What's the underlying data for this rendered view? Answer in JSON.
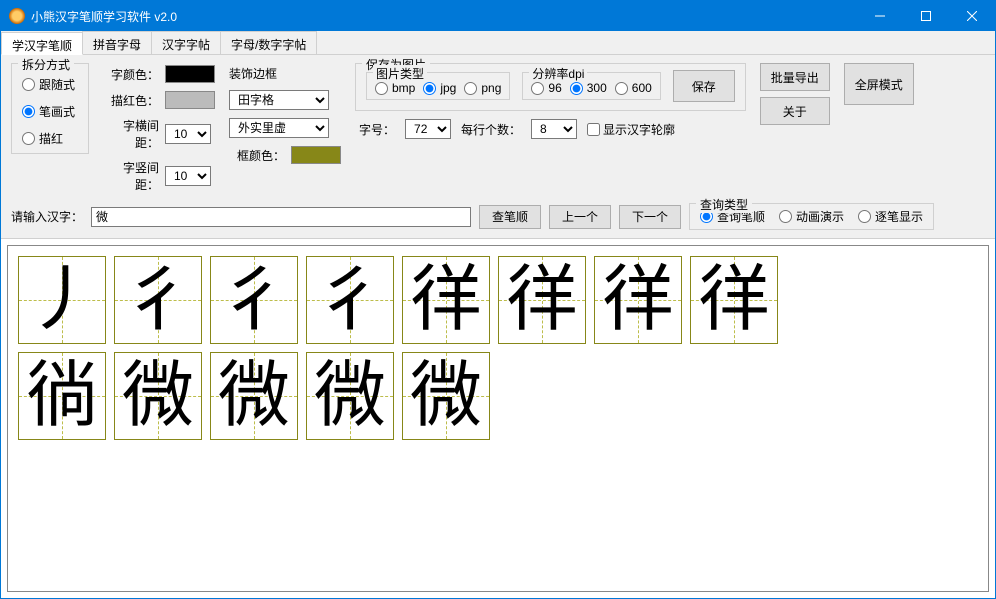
{
  "window": {
    "title": "小熊汉字笔顺学习软件 v2.0"
  },
  "tabs": [
    {
      "label": "学汉字笔顺",
      "active": true
    },
    {
      "label": "拼音字母",
      "active": false
    },
    {
      "label": "汉字字帖",
      "active": false
    },
    {
      "label": "字母/数字字帖",
      "active": false
    }
  ],
  "split": {
    "title": "拆分方式",
    "options": [
      "跟随式",
      "笔画式",
      "描红"
    ],
    "selected": "笔画式"
  },
  "font": {
    "color_label": "字颜色：",
    "trace_label": "描红色：",
    "hspace_label": "字横间距：",
    "vspace_label": "字竖间距：",
    "hspace_value": "10",
    "vspace_value": "10"
  },
  "decor": {
    "title": "装饰边框",
    "grid_style": "田字格",
    "border_style": "外实里虚",
    "frame_color_label": "框颜色："
  },
  "save": {
    "title": "保存为图片",
    "img_type_title": "图片类型",
    "img_types": [
      "bmp",
      "jpg",
      "png"
    ],
    "img_type_selected": "jpg",
    "dpi_title": "分辨率dpi",
    "dpi_options": [
      "96",
      "300",
      "600"
    ],
    "dpi_selected": "300",
    "save_btn": "保存",
    "font_size_label": "字号：",
    "font_size_value": "72",
    "per_line_label": "每行个数：",
    "per_line_value": "8",
    "outline_label": "显示汉字轮廓"
  },
  "buttons": {
    "batch_export": "批量导出",
    "about": "关于",
    "fullscreen": "全屏模式"
  },
  "input": {
    "label": "请输入汉字：",
    "value": "微",
    "lookup_btn": "查笔顺",
    "prev_btn": "上一个",
    "next_btn": "下一个"
  },
  "query": {
    "title": "查询类型",
    "options": [
      "查询笔顺",
      "动画演示",
      "逐笔显示"
    ],
    "selected": "查询笔顺"
  },
  "strokes": {
    "char": "微",
    "count": 13,
    "cells": [
      "丿",
      "彳",
      "彳",
      "彳",
      "徉",
      "徉",
      "徉",
      "徉",
      "徜",
      "微",
      "微",
      "微",
      "微"
    ]
  }
}
